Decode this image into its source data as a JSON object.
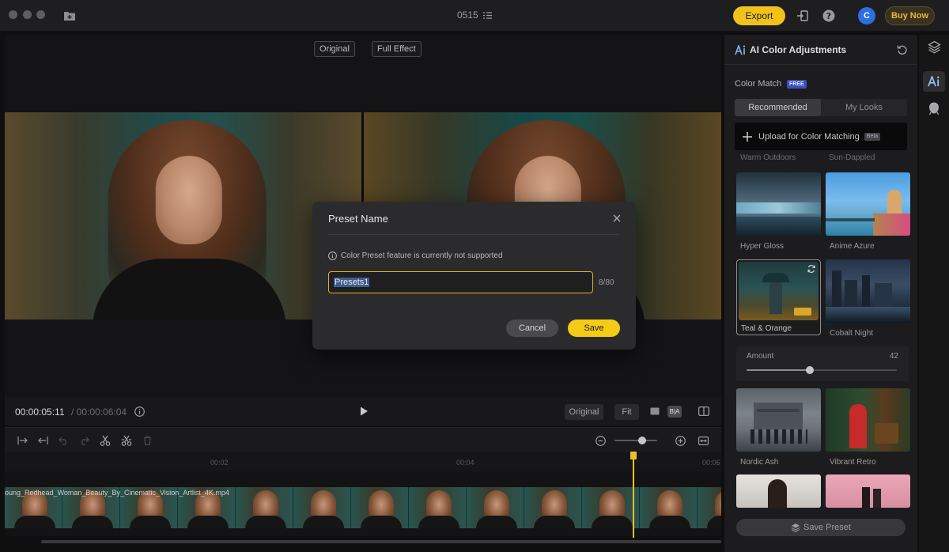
{
  "titlebar": {
    "project_name": "0515",
    "export_label": "Export",
    "avatar_initial": "C",
    "buy_label": "Buy Now"
  },
  "preview": {
    "original_label": "Original",
    "full_effect_label": "Full Effect"
  },
  "playback": {
    "current_time": "00:00:05:11",
    "total_time": "/ 00:00:06:04",
    "original_label": "Original",
    "fit_label": "Fit",
    "ba_label": "B|A"
  },
  "timeline": {
    "ruler_labels": [
      "00:02",
      "00:04",
      "00:06"
    ],
    "clip_name": "oung_Redhead_Woman_Beauty_By_Cinematic_Vision_Artlist_4K.mp4",
    "zoom_fraction": 0.65
  },
  "panel": {
    "title": "AI Color Adjustments",
    "color_match_label": "Color Match",
    "free_badge": "FREE",
    "tabs": [
      {
        "label": "Recommended",
        "active": true
      },
      {
        "label": "My Looks",
        "active": false
      }
    ],
    "upload_label": "Upload for Color Matching",
    "beta_badge": "Beta",
    "partial_labels": [
      "Warm Outdoors",
      "Sun-Dappled"
    ],
    "presets": [
      {
        "label": "Hyper Gloss"
      },
      {
        "label": "Anime Azure"
      },
      {
        "label": "Teal & Orange",
        "selected": true
      },
      {
        "label": "Cobalt Night"
      },
      {
        "label": "Nordic Ash"
      },
      {
        "label": "Vibrant Retro"
      }
    ],
    "amount_label": "Amount",
    "amount_value": "42",
    "amount_fraction": 0.42,
    "save_preset_label": "Save Preset"
  },
  "dialog": {
    "title": "Preset Name",
    "info_text": "Color Preset feature is currently not supported",
    "input_value": "Presets1",
    "char_count": "8/80",
    "cancel_label": "Cancel",
    "save_label": "Save"
  },
  "colors": {
    "accent": "#f4cc16",
    "avatar": "#2d6fe0",
    "selection": "#3f5c8e"
  }
}
